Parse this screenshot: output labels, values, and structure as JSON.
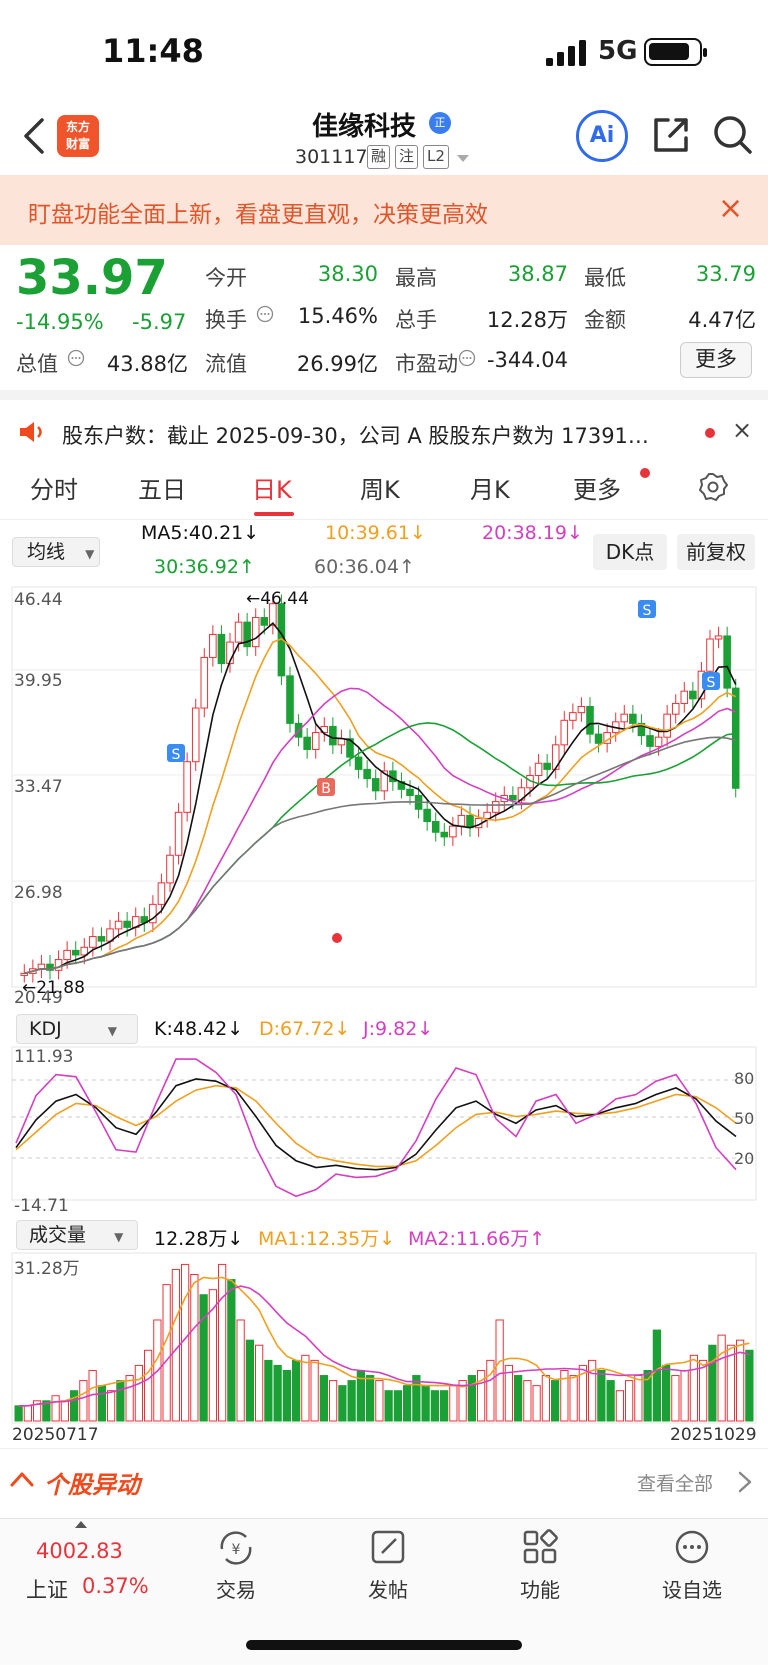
{
  "status": {
    "time": "11:48",
    "network": "5G"
  },
  "header": {
    "logo_line1": "东方",
    "logo_line2": "财富",
    "name": "佳缘科技",
    "badge": "正",
    "code": "301117",
    "tags": [
      "融",
      "注",
      "L2"
    ],
    "ai_label": "Ai"
  },
  "banner": {
    "text": "盯盘功能全面上新，看盘更直观，决策更高效",
    "close": "×"
  },
  "quote": {
    "price": "33.97",
    "pct": "-14.95%",
    "change": "-5.97",
    "rows": [
      [
        {
          "label": "今开",
          "value": "38.30",
          "color": "green"
        },
        {
          "label": "最高",
          "value": "38.87",
          "color": "green"
        },
        {
          "label": "最低",
          "value": "33.79",
          "color": "green"
        }
      ],
      [
        {
          "label": "换手",
          "value": "15.46%",
          "color": "black"
        },
        {
          "label": "总手",
          "value": "12.28万",
          "color": "black"
        },
        {
          "label": "金额",
          "value": "4.47亿",
          "color": "black"
        }
      ],
      [
        {
          "label": "总值",
          "value": "43.88亿",
          "color": "black"
        },
        {
          "label": "流值",
          "value": "26.99亿",
          "color": "black"
        },
        {
          "label": "市盈动",
          "value": "-344.04",
          "color": "black"
        }
      ]
    ],
    "more_label": "更多"
  },
  "news": {
    "text": "股东户数：截止 2025-09-30，公司 A 股股东户数为 17391…",
    "close": "×"
  },
  "tabs": [
    "分时",
    "五日",
    "日K",
    "周K",
    "月K",
    "更多"
  ],
  "ma": {
    "select": "均线",
    "ma5": "MA5:40.21↓",
    "ma10": "10:39.61↓",
    "ma20": "20:38.19↓",
    "ma30": "30:36.92↑",
    "ma60": "60:36.04↑",
    "dk_label": "DK点",
    "fq_label": "前复权"
  },
  "kline": {
    "price_axis": [
      "46.44",
      "39.95",
      "33.47",
      "26.98",
      "20.49"
    ],
    "high_marker": "←46.44",
    "low_marker": "←21.88",
    "signals": [
      "S",
      "B",
      "S",
      "S"
    ],
    "colors": {
      "up": "#e8333a",
      "down": "#1aa034",
      "ma5": "#111111",
      "ma10": "#f0a020",
      "ma20": "#d43fc1",
      "ma30": "#1aa034",
      "ma60": "#777777"
    }
  },
  "kdj": {
    "select": "KDJ",
    "k": "K:48.42↓",
    "d": "D:67.72↓",
    "j": "J:9.82↓",
    "axis_top": "111.93",
    "axis_bottom": "-14.71",
    "levels": [
      "80",
      "50",
      "20"
    ]
  },
  "volume": {
    "select": "成交量",
    "value": "12.28万↓",
    "ma1": "MA1:12.35万↓",
    "ma2": "MA2:11.66万↑",
    "axis_top": "31.28万",
    "date_start": "20250717",
    "date_end": "20251029"
  },
  "movers": {
    "title": "个股异动",
    "view_all": "查看全部"
  },
  "bottom_nav": {
    "index_value": "4002.83",
    "index_name": "上证",
    "index_pct": "0.37%",
    "items": [
      "交易",
      "发帖",
      "功能",
      "设自选"
    ]
  }
}
